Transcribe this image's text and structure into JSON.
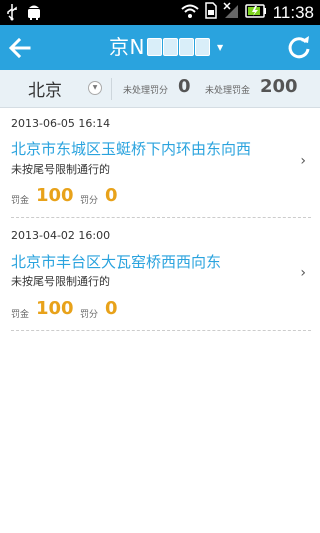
{
  "status_bar": {
    "time": "11:38",
    "icons": [
      "usb-icon",
      "android-debug-icon",
      "wifi-icon",
      "sim-icon",
      "no-signal-icon",
      "battery-charging-icon"
    ]
  },
  "header": {
    "plate_prefix": "京N",
    "back_icon": "back-arrow-icon",
    "refresh_icon": "refresh-icon",
    "accent": "#2aa3de"
  },
  "summary": {
    "city": "北京",
    "pending_points_label": "未处理罚分",
    "pending_points": "0",
    "pending_fine_label": "未处理罚金",
    "pending_fine": "200"
  },
  "records": [
    {
      "datetime": "2013-06-05 16:14",
      "location": "北京市东城区玉蜓桥下内环由东向西",
      "reason": "未按尾号限制通行的",
      "fine_label": "罚金",
      "fine": "100",
      "points_label": "罚分",
      "points": "0"
    },
    {
      "datetime": "2013-04-02 16:00",
      "location": "北京市丰台区大瓦窑桥西西向东",
      "reason": "未按尾号限制通行的",
      "fine_label": "罚金",
      "fine": "100",
      "points_label": "罚分",
      "points": "0"
    }
  ],
  "colors": {
    "amount": "#e8a21a",
    "location": "#2aa3de"
  }
}
